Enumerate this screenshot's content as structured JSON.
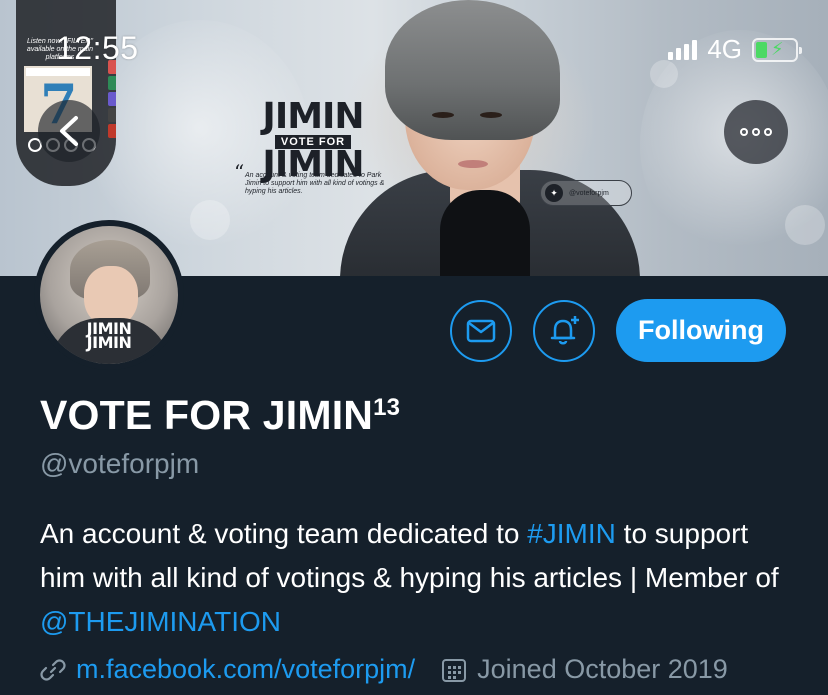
{
  "status_bar": {
    "time": "12:55",
    "network": "4G",
    "battery_level": 0.3,
    "battery_charging": true
  },
  "pip_widget": {
    "caption": "Listen now! \"FILTER\" available on the main platforms"
  },
  "banner": {
    "logo_text_top": "JIMIN",
    "logo_vote_for": "VOTE FOR",
    "logo_text_bottom": "JIMIN",
    "description": "An account & voting team dedicated to Park Jimin to support him with all kind of votings & hyping his articles.",
    "twitter_handle": "@voteforpjm"
  },
  "avatar": {
    "logo_line1": "JIMIN",
    "logo_line2": "JIMIN"
  },
  "actions": {
    "follow_label": "Following"
  },
  "profile": {
    "display_name": "VOTE FOR JIMIN",
    "display_name_suffix": "13",
    "username": "@voteforpjm",
    "bio_part1": "An account & voting team dedicated to ",
    "bio_hashtag": "#JIMIN",
    "bio_part2": " to support him with all kind of votings & hyping his articles | Member of ",
    "bio_mention": "@THEJIMINATION",
    "website": "m.facebook.com/voteforpjm/",
    "joined": "Joined October 2019"
  },
  "colors": {
    "background": "#15202b",
    "accent": "#1d9bf0",
    "secondary_text": "#8899a6"
  }
}
